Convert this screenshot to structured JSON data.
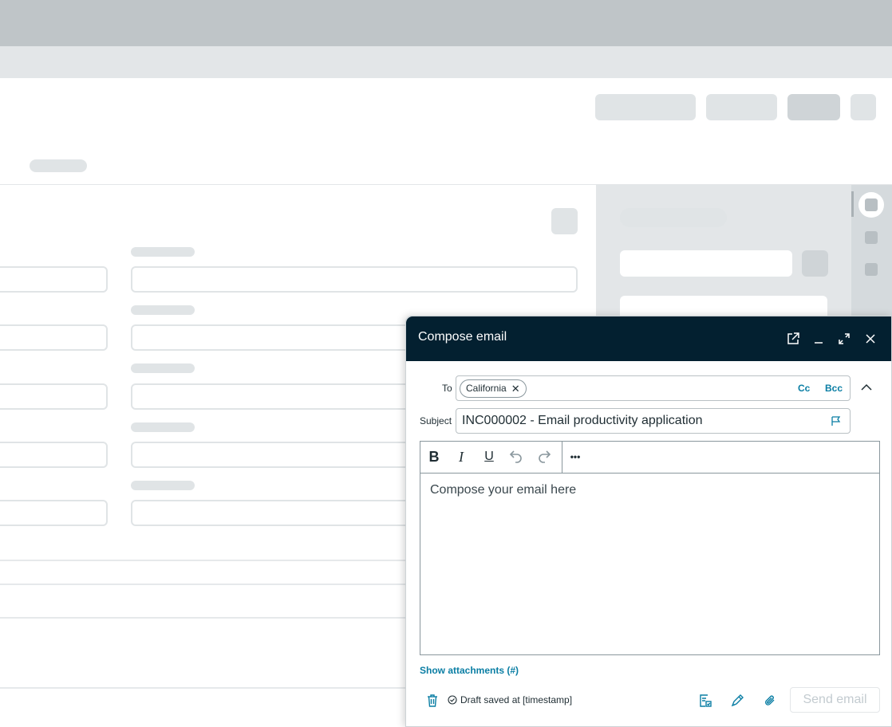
{
  "compose": {
    "title": "Compose email",
    "to_label": "To",
    "recipients": [
      "California"
    ],
    "cc_label": "Cc",
    "bcc_label": "Bcc",
    "subject_label": "Subject",
    "subject_value": "INC000002 - Email productivity application",
    "body_placeholder": "Compose your email here",
    "show_attachments": "Show attachments (#)",
    "draft_status": "Draft saved at [timestamp]",
    "send_label": "Send email",
    "toolbar": {
      "bold": "B",
      "italic": "I",
      "underline": "U",
      "more": "•••"
    }
  },
  "colors": {
    "header_bg": "#032030",
    "link": "#0a7ea4",
    "disabled_text": "#c3cbd0",
    "placeholder_skeleton": "#e0e4e6"
  },
  "icons": {
    "header": [
      "open-in-new-window-icon",
      "minimize-icon",
      "expand-icon",
      "close-icon"
    ],
    "footer": [
      "trash-icon",
      "check-circle-icon",
      "template-icon",
      "signature-icon",
      "attachment-icon"
    ]
  }
}
